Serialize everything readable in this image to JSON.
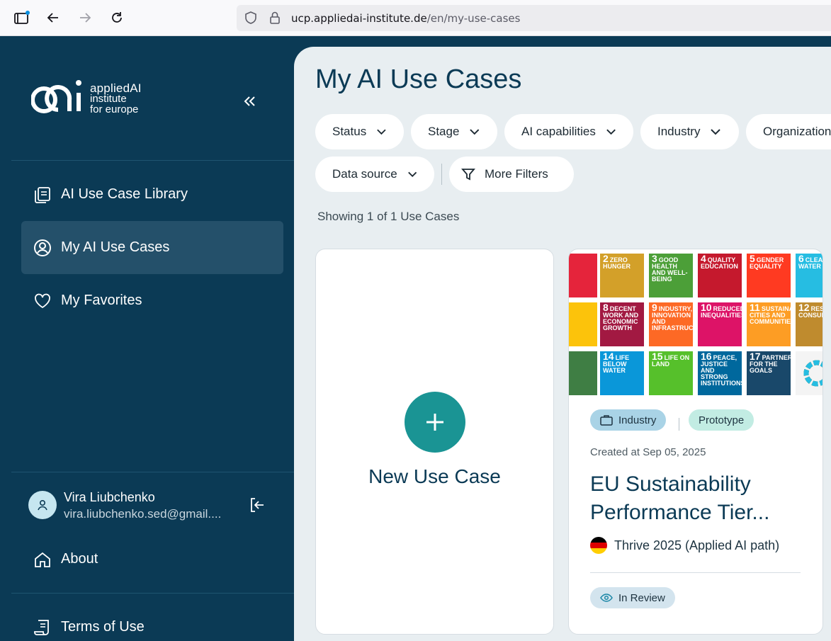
{
  "browser": {
    "url_host": "ucp.appliedai-institute.de",
    "url_path": "/en/my-use-cases"
  },
  "sidebar": {
    "logo": {
      "line1": "appliedAI",
      "line2": "institute",
      "line3": "for europe"
    },
    "collapse_icon": "double-chevron-left-icon",
    "nav": [
      {
        "label": "AI Use Case Library",
        "icon": "library-icon",
        "active": false
      },
      {
        "label": "My AI Use Cases",
        "icon": "user-circle-icon",
        "active": true
      },
      {
        "label": "My Favorites",
        "icon": "heart-icon",
        "active": false
      }
    ],
    "user": {
      "name": "Vira Liubchenko",
      "email": "vira.liubchenko.sed@gmail...."
    },
    "about_label": "About",
    "terms_label": "Terms of Use"
  },
  "main": {
    "title": "My AI Use Cases",
    "filters": [
      "Status",
      "Stage",
      "AI capabilities",
      "Industry",
      "Organization",
      "Data source"
    ],
    "more_filters_label": "More Filters",
    "showing_text": "Showing 1 of 1 Use Cases",
    "new_card_label": "New Use Case",
    "use_case": {
      "tags": [
        "Industry",
        "Prototype"
      ],
      "created": "Created at Sep 05, 2025",
      "title": "EU Sustainability Performance Tier...",
      "organization": "Thrive 2025 (Applied AI path)",
      "status": "In Review"
    }
  },
  "sdg_tiles": [
    {
      "num": "2",
      "text": "ZERO HUNGER",
      "color": "#d3a029"
    },
    {
      "num": "3",
      "text": "GOOD HEALTH AND WELL-BEING",
      "color": "#4c9f38"
    },
    {
      "num": "4",
      "text": "QUALITY EDUCATION",
      "color": "#c5192d"
    },
    {
      "num": "5",
      "text": "GENDER EQUALITY",
      "color": "#ff3a21"
    },
    {
      "num": "6",
      "text": "CLEAN WATER",
      "color": "#26bde2"
    },
    {
      "num": "8",
      "text": "DECENT WORK AND ECONOMIC GROWTH",
      "color": "#a21942"
    },
    {
      "num": "9",
      "text": "INDUSTRY, INNOVATION AND INFRASTRUCTURE",
      "color": "#fd6925"
    },
    {
      "num": "10",
      "text": "REDUCED INEQUALITIES",
      "color": "#dd1367"
    },
    {
      "num": "11",
      "text": "SUSTAINABLE CITIES AND COMMUNITIES",
      "color": "#fd9d24"
    },
    {
      "num": "12",
      "text": "RESPONSIBLE CONSUMPTION",
      "color": "#bf8b2e"
    },
    {
      "num": "14",
      "text": "LIFE BELOW WATER",
      "color": "#0a97d9"
    },
    {
      "num": "15",
      "text": "LIFE ON LAND",
      "color": "#56c02b"
    },
    {
      "num": "16",
      "text": "PEACE, JUSTICE AND STRONG INSTITUTIONS",
      "color": "#00689d"
    },
    {
      "num": "17",
      "text": "PARTNERSHIPS FOR THE GOALS",
      "color": "#19486a"
    }
  ],
  "colors": {
    "sidebar_bg": "#0b3a55",
    "accent": "#1a9494",
    "main_bg": "#e8eef1"
  }
}
